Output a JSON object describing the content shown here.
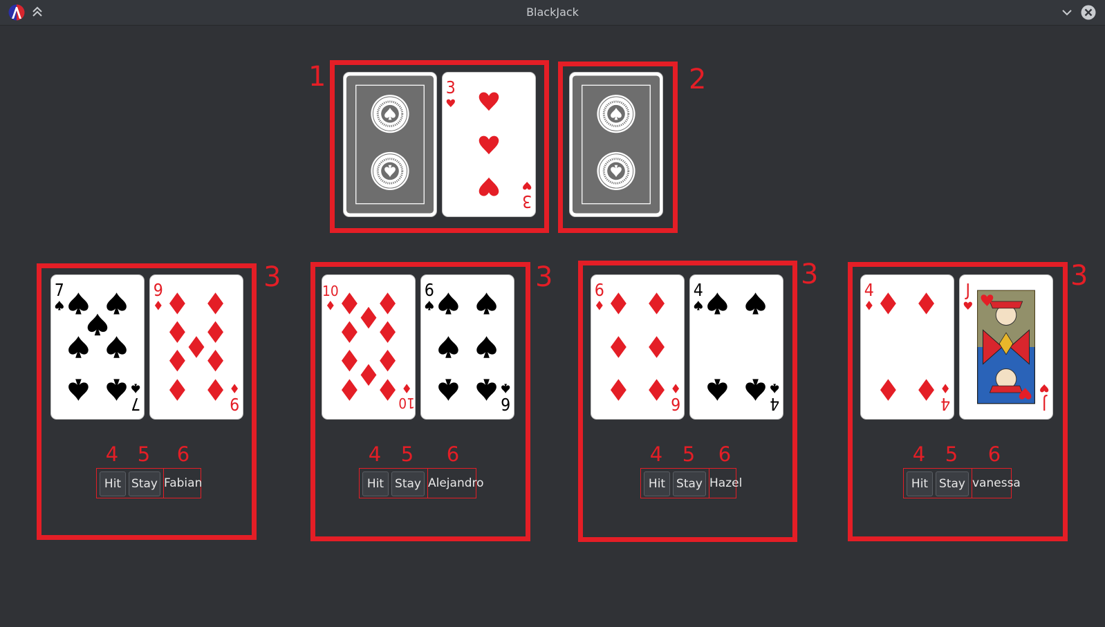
{
  "window": {
    "title": "BlackJack",
    "logo_icon": "racket-logo-icon",
    "keep_above_icon": "double-chevron-up-icon",
    "minimize_icon": "chevron-down-icon",
    "close_icon": "close-icon"
  },
  "colors": {
    "background": "#303236",
    "annotation": "#e41e26",
    "red_suit": "#e41e26",
    "black_suit": "#000000",
    "card_back": "#6e6e6e"
  },
  "dealer": {
    "zone_label": "1",
    "cards": [
      {
        "face_down": true
      },
      {
        "rank": "3",
        "suit": "hearts"
      }
    ]
  },
  "deck": {
    "zone_label": "2",
    "cards": [
      {
        "face_down": true
      }
    ]
  },
  "players": [
    {
      "zone_label": "3",
      "name": "Fabian",
      "hit_label": "Hit",
      "stay_label": "Stay",
      "hit_marker": "4",
      "stay_marker": "5",
      "name_marker": "6",
      "cards": [
        {
          "rank": "7",
          "suit": "spades"
        },
        {
          "rank": "9",
          "suit": "diamonds"
        }
      ]
    },
    {
      "zone_label": "3",
      "name": "Alejandro",
      "hit_label": "Hit",
      "stay_label": "Stay",
      "hit_marker": "4",
      "stay_marker": "5",
      "name_marker": "6",
      "cards": [
        {
          "rank": "10",
          "suit": "diamonds"
        },
        {
          "rank": "6",
          "suit": "spades"
        }
      ]
    },
    {
      "zone_label": "3",
      "name": "Hazel",
      "hit_label": "Hit",
      "stay_label": "Stay",
      "hit_marker": "4",
      "stay_marker": "5",
      "name_marker": "6",
      "cards": [
        {
          "rank": "6",
          "suit": "diamonds"
        },
        {
          "rank": "4",
          "suit": "spades"
        }
      ]
    },
    {
      "zone_label": "3",
      "name": "vanessa",
      "hit_label": "Hit",
      "stay_label": "Stay",
      "hit_marker": "4",
      "stay_marker": "5",
      "name_marker": "6",
      "cards": [
        {
          "rank": "4",
          "suit": "diamonds"
        },
        {
          "rank": "J",
          "suit": "hearts"
        }
      ]
    }
  ]
}
